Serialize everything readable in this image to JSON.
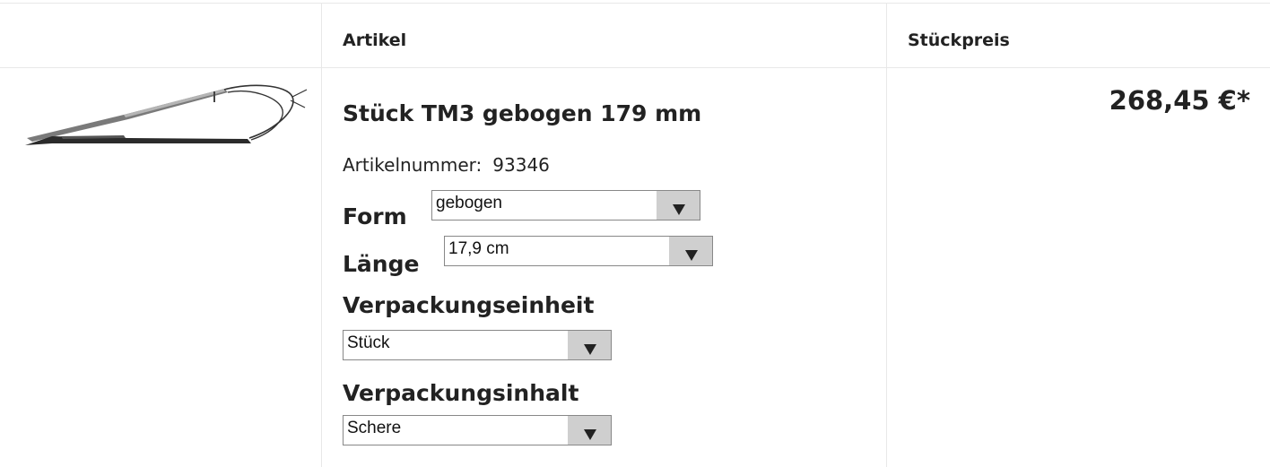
{
  "header": {
    "col_article": "Artikel",
    "col_unit_price": "Stückpreis"
  },
  "product": {
    "image_icon": "surgical-scissors-image",
    "title": "Stück TM3 gebogen 179 mm",
    "article_number_label": "Artikelnummer:",
    "article_number": "93346",
    "price": "268,45 €*"
  },
  "options": {
    "form": {
      "label": "Form",
      "selected": "gebogen"
    },
    "length": {
      "label": "Länge",
      "selected": "17,9 cm"
    },
    "packaging_unit": {
      "label": "Verpackungseinheit",
      "selected": "Stück"
    },
    "packaging_content": {
      "label": "Verpackungsinhalt",
      "selected": "Schere"
    }
  },
  "colors": {
    "border": "#e8e8e8",
    "select_arrow_bg": "#cfcfcf",
    "text": "#222222"
  }
}
